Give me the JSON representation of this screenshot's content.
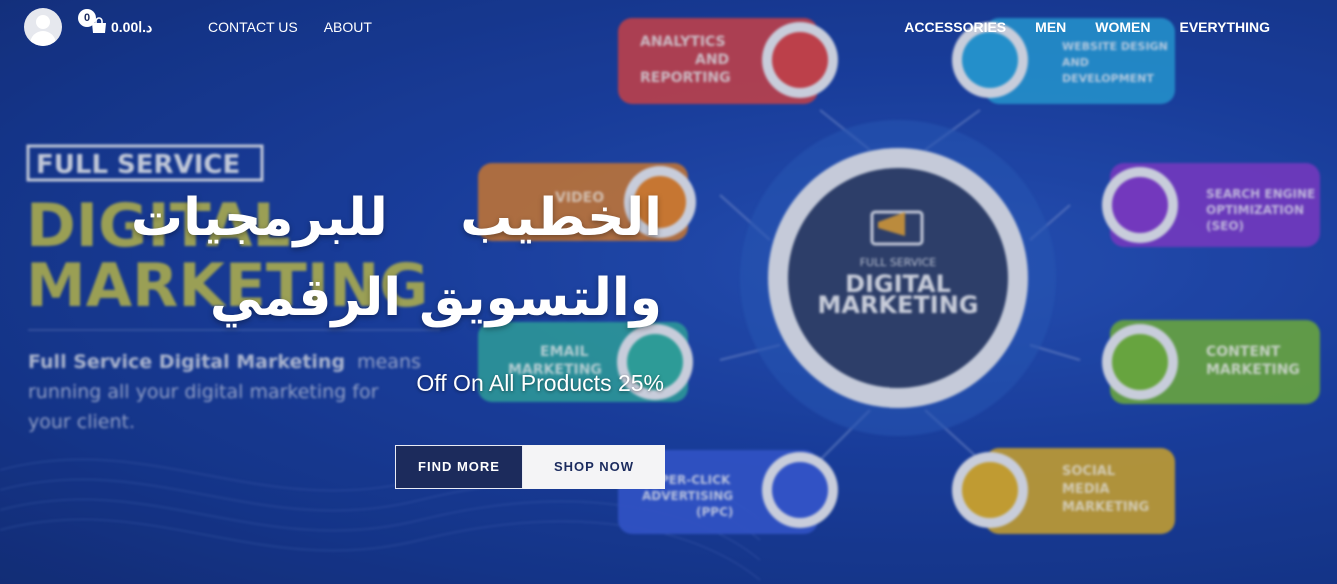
{
  "header": {
    "cart_count": "0",
    "cart_total": "0.00د.ا",
    "nav_left": [
      "CONTACT US",
      "ABOUT"
    ],
    "nav_right": [
      "ACCESSORIES",
      "MEN",
      "WOMEN",
      "EVERYTHING"
    ]
  },
  "hero": {
    "title_line1": "الخطيب    للبرمجيات",
    "title_line2": "والتسويق الرقمي",
    "subtitle": "Off On All Products 25%",
    "find_more_label": "FIND MORE",
    "shop_now_label": "SHOP NOW"
  },
  "background_image": {
    "badge": "FULL SERVICE",
    "headline_line1": "DIGITAL",
    "headline_line2": "MARKETING",
    "description_bold": "Full Service Digital Marketing",
    "description_rest1": "means",
    "description_line2": "running all your digital marketing for",
    "description_line3": "your client.",
    "center_line1": "FULL SERVICE",
    "center_line2": "DIGITAL",
    "center_line3": "MARKETING",
    "nodes": [
      {
        "lines": [
          "ANALYTICS",
          "AND",
          "REPORTING"
        ],
        "color": "#e3484a"
      },
      {
        "lines": [
          "WEBSITE DESIGN",
          "AND",
          "DEVELOPMENT"
        ],
        "color": "#2aa9e6"
      },
      {
        "lines": [
          "VIDEO"
        ],
        "color": "#f08a2c"
      },
      {
        "lines": [
          "SEARCH ENGINE",
          "OPTIMIZATION",
          "(SEO)"
        ],
        "color": "#8a3fd6"
      },
      {
        "lines": [
          "EMAIL",
          "MARKETING"
        ],
        "color": "#35b8a8"
      },
      {
        "lines": [
          "CONTENT",
          "MARKETING"
        ],
        "color": "#7cc23c"
      },
      {
        "lines": [
          "PER-CLICK",
          "ADVERTISING",
          "(PPC)"
        ],
        "color": "#3a5fe0"
      },
      {
        "lines": [
          "SOCIAL",
          "MEDIA",
          "MARKETING"
        ],
        "color": "#e8b82c"
      }
    ]
  },
  "colors": {
    "button_dark": "#1c2b5c",
    "button_light": "#f4f4f6",
    "hero_blue": "#1d45ac"
  }
}
